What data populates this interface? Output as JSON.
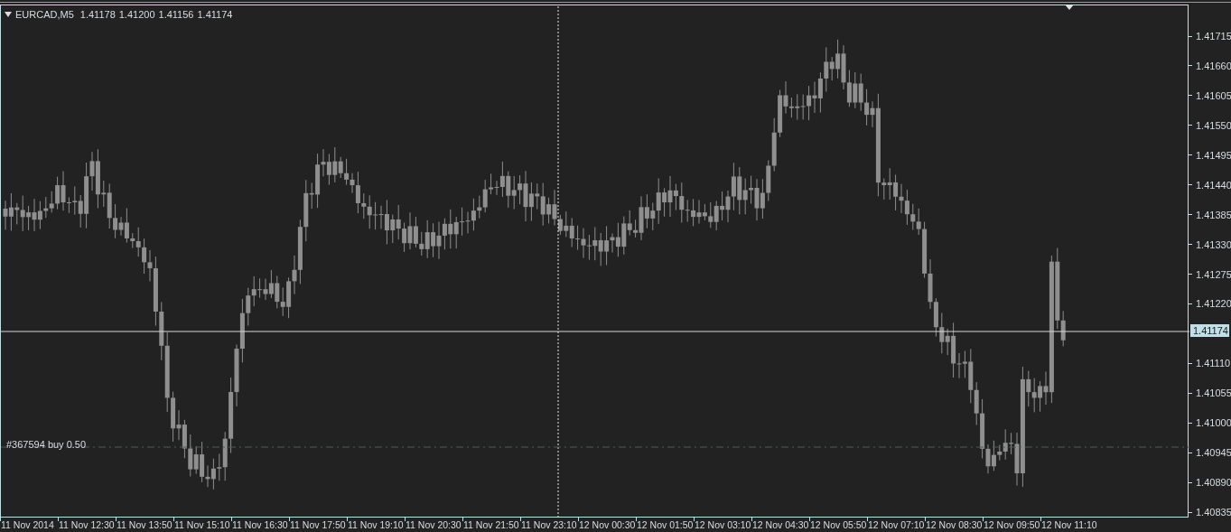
{
  "chart_header": {
    "symbol": "EURCAD,M5",
    "values": [
      "1.41178",
      "1.41200",
      "1.41156",
      "1.41174"
    ]
  },
  "price_axis": {
    "ticks": [
      "1.41715",
      "1.41660",
      "1.41605",
      "1.41550",
      "1.41495",
      "1.41440",
      "1.41385",
      "1.41330",
      "1.41275",
      "1.41220",
      "1.41110",
      "1.41055",
      "1.41000",
      "1.40945",
      "1.40890",
      "1.40835"
    ],
    "current_price": "1.41174"
  },
  "order_line": {
    "label": "#367594 buy 0.50"
  },
  "time_axis": {
    "labels": [
      "11 Nov 2014",
      "11 Nov 12:30",
      "11 Nov 13:50",
      "11 Nov 15:10",
      "11 Nov 16:30",
      "11 Nov 17:50",
      "11 Nov 19:10",
      "11 Nov 20:30",
      "11 Nov 21:50",
      "11 Nov 23:10",
      "12 Nov 00:30",
      "12 Nov 01:50",
      "12 Nov 03:10",
      "12 Nov 04:30",
      "12 Nov 05:50",
      "12 Nov 07:10",
      "12 Nov 08:30",
      "12 Nov 09:50",
      "12 Nov 11:10"
    ]
  }
}
